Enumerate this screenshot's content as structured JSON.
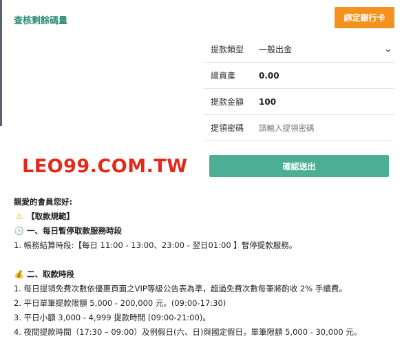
{
  "header": {
    "check_link": "查核剩餘碼量",
    "bind_button": "綁定銀行卡"
  },
  "form": {
    "type_label": "提款類型",
    "type_value": "一般出金",
    "assets_label": "總資產",
    "assets_value": "0.00",
    "amount_label": "提款金額",
    "amount_value": "100",
    "password_label": "提領密碼",
    "password_placeholder": "請輸入提領密碼",
    "confirm_button": "確認送出"
  },
  "watermark": "LEO99.COM.TW",
  "notice": {
    "greeting": "親愛的會員您好:",
    "rules_title": "【取款規範】",
    "section1_title": "一、每日暫停取款服務時段",
    "section1_items": [
      "1. 帳務結算時段:【每日 11:00 - 13:00、23:00 - 翌日01:00 】暫停提款服務。"
    ],
    "section2_title": "二、取款時段",
    "section2_items": [
      "1. 每日提領免費次數依優惠頁面之VIP等級公告表為準，超過免費次數每筆將酌收 2% 手續費。",
      "2. 平日單筆提款限額 5,000 - 200,000 元。(09:00-17:30)",
      "3. 平日小額 3,000 - 4,999 提款時間 (09:00-21:00)。",
      "4. 夜間提款時間（17:30 – 09:00）及例假日(六、日)與國定假日，單筆限額 5,000 - 30,000 元。"
    ]
  },
  "icons": {
    "warning": "warning-icon",
    "clock": "clock-icon",
    "money_bag": "money-bag-icon",
    "chevron": "chevron-down-icon"
  },
  "colors": {
    "accent_green": "#4caf93",
    "link_green": "#2e8b72",
    "orange": "#f5921e",
    "watermark_red": "#e2291b"
  }
}
